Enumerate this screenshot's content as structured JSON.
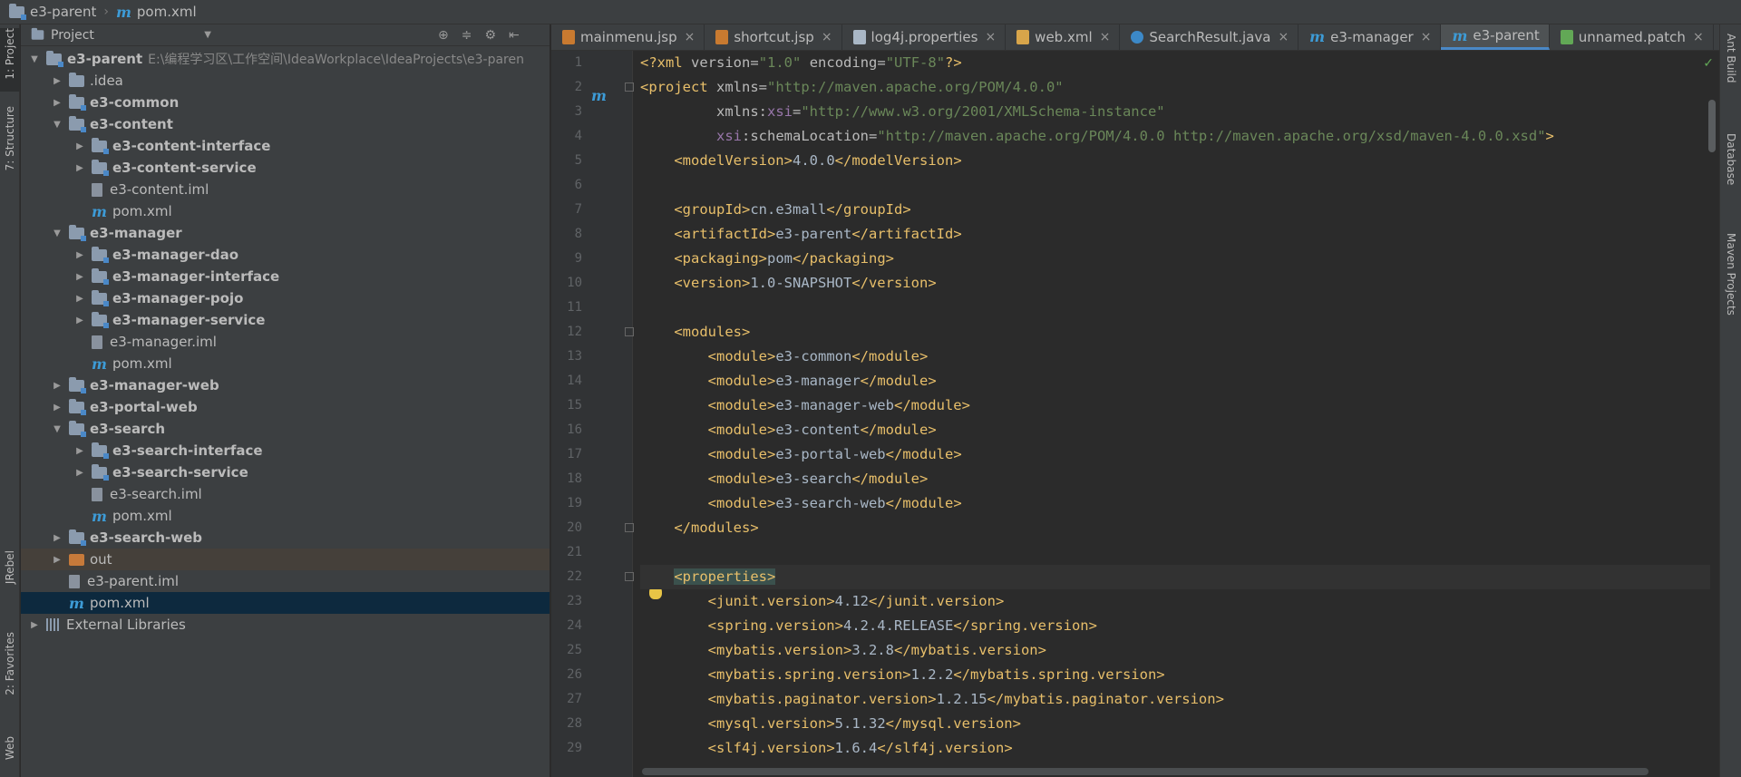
{
  "breadcrumb": {
    "project": "e3-parent",
    "file": "pom.xml"
  },
  "left_strip": [
    {
      "label": "1: Project"
    },
    {
      "label": "7: Structure"
    },
    {
      "label": "JRebel"
    },
    {
      "label": "2: Favorites"
    },
    {
      "label": "Web"
    }
  ],
  "right_strip": [
    {
      "label": "Ant Build"
    },
    {
      "label": "Database"
    },
    {
      "label": "Maven Projects"
    }
  ],
  "project_panel": {
    "title": "Project",
    "tree": [
      {
        "label": "e3-parent",
        "path": "E:\\编程学习区\\工作空间\\IdeaWorkplace\\IdeaProjects\\e3-paren",
        "depth": 0,
        "expanded": true,
        "type": "module",
        "bold": true
      },
      {
        "label": ".idea",
        "depth": 1,
        "expanded": false,
        "type": "folder",
        "bold": false
      },
      {
        "label": "e3-common",
        "depth": 1,
        "expanded": false,
        "type": "module",
        "bold": true
      },
      {
        "label": "e3-content",
        "depth": 1,
        "expanded": true,
        "type": "module",
        "bold": true
      },
      {
        "label": "e3-content-interface",
        "depth": 2,
        "expanded": false,
        "type": "module",
        "bold": true
      },
      {
        "label": "e3-content-service",
        "depth": 2,
        "expanded": false,
        "type": "module",
        "bold": true
      },
      {
        "label": "e3-content.iml",
        "depth": 2,
        "type": "iml"
      },
      {
        "label": "pom.xml",
        "depth": 2,
        "type": "pom"
      },
      {
        "label": "e3-manager",
        "depth": 1,
        "expanded": true,
        "type": "module",
        "bold": true
      },
      {
        "label": "e3-manager-dao",
        "depth": 2,
        "expanded": false,
        "type": "module",
        "bold": true
      },
      {
        "label": "e3-manager-interface",
        "depth": 2,
        "expanded": false,
        "type": "module",
        "bold": true
      },
      {
        "label": "e3-manager-pojo",
        "depth": 2,
        "expanded": false,
        "type": "module",
        "bold": true
      },
      {
        "label": "e3-manager-service",
        "depth": 2,
        "expanded": false,
        "type": "module",
        "bold": true
      },
      {
        "label": "e3-manager.iml",
        "depth": 2,
        "type": "iml"
      },
      {
        "label": "pom.xml",
        "depth": 2,
        "type": "pom"
      },
      {
        "label": "e3-manager-web",
        "depth": 1,
        "expanded": false,
        "type": "module",
        "bold": true
      },
      {
        "label": "e3-portal-web",
        "depth": 1,
        "expanded": false,
        "type": "module",
        "bold": true
      },
      {
        "label": "e3-search",
        "depth": 1,
        "expanded": true,
        "type": "module",
        "bold": true
      },
      {
        "label": "e3-search-interface",
        "depth": 2,
        "expanded": false,
        "type": "module",
        "bold": true
      },
      {
        "label": "e3-search-service",
        "depth": 2,
        "expanded": false,
        "type": "module",
        "bold": true
      },
      {
        "label": "e3-search.iml",
        "depth": 2,
        "type": "iml"
      },
      {
        "label": "pom.xml",
        "depth": 2,
        "type": "pom"
      },
      {
        "label": "e3-search-web",
        "depth": 1,
        "expanded": false,
        "type": "module",
        "bold": true
      },
      {
        "label": "out",
        "depth": 1,
        "expanded": false,
        "type": "out",
        "bold": false
      },
      {
        "label": "e3-parent.iml",
        "depth": 1,
        "type": "iml"
      },
      {
        "label": "pom.xml",
        "depth": 1,
        "type": "pom",
        "selected": true
      },
      {
        "label": "External Libraries",
        "depth": 0,
        "expanded": false,
        "type": "lib",
        "bold": false
      }
    ]
  },
  "tabs": [
    {
      "label": "mainmenu.jsp",
      "icon": "jsp-icon",
      "closable": true
    },
    {
      "label": "shortcut.jsp",
      "icon": "jsp-icon",
      "closable": true
    },
    {
      "label": "log4j.properties",
      "icon": "properties-icon",
      "closable": true
    },
    {
      "label": "web.xml",
      "icon": "xml-icon",
      "closable": true
    },
    {
      "label": "SearchResult.java",
      "icon": "java-class-icon",
      "closable": true
    },
    {
      "label": "e3-manager",
      "icon": "maven-icon",
      "closable": true
    },
    {
      "label": "e3-parent",
      "icon": "maven-icon",
      "closable": false,
      "active": true
    },
    {
      "label": "unnamed.patch",
      "icon": "patch-icon",
      "closable": true
    }
  ],
  "editor": {
    "lines": [
      "<?xml version=\"1.0\" encoding=\"UTF-8\"?>",
      "<project xmlns=\"http://maven.apache.org/POM/4.0.0\"",
      "         xmlns:xsi=\"http://www.w3.org/2001/XMLSchema-instance\"",
      "         xsi:schemaLocation=\"http://maven.apache.org/POM/4.0.0 http://maven.apache.org/xsd/maven-4.0.0.xsd\">",
      "    <modelVersion>4.0.0</modelVersion>",
      "",
      "    <groupId>cn.e3mall</groupId>",
      "    <artifactId>e3-parent</artifactId>",
      "    <packaging>pom</packaging>",
      "    <version>1.0-SNAPSHOT</version>",
      "",
      "    <modules>",
      "        <module>e3-common</module>",
      "        <module>e3-manager</module>",
      "        <module>e3-manager-web</module>",
      "        <module>e3-content</module>",
      "        <module>e3-portal-web</module>",
      "        <module>e3-search</module>",
      "        <module>e3-search-web</module>",
      "    </modules>",
      "",
      "    <properties>",
      "        <junit.version>4.12</junit.version>",
      "        <spring.version>4.2.4.RELEASE</spring.version>",
      "        <mybatis.version>3.2.8</mybatis.version>",
      "        <mybatis.spring.version>1.2.2</mybatis.spring.version>",
      "        <mybatis.paginator.version>1.2.15</mybatis.paginator.version>",
      "        <mysql.version>5.1.32</mysql.version>",
      "        <slf4j.version>1.6.4</slf4j.version>"
    ],
    "current_line": 22
  }
}
